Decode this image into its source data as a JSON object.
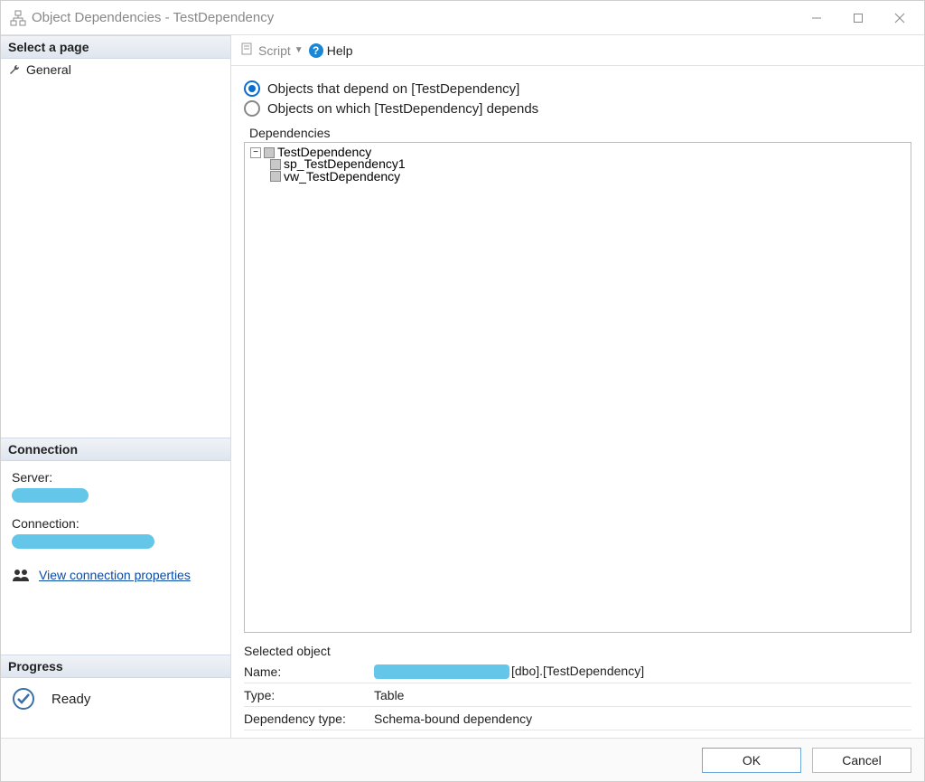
{
  "titlebar": {
    "title": "Object Dependencies - TestDependency"
  },
  "left": {
    "select_page_header": "Select a page",
    "pages": {
      "general": "General"
    },
    "connection_header": "Connection",
    "server_label": "Server:",
    "connection_label": "Connection:",
    "view_conn_props": "View connection properties",
    "progress_header": "Progress",
    "progress_status": "Ready"
  },
  "toolbar": {
    "script": "Script",
    "help": "Help"
  },
  "main": {
    "radio_depend_on": "Objects that depend on [TestDependency]",
    "radio_depends": "Objects on which [TestDependency] depends",
    "dependencies_label": "Dependencies",
    "tree": {
      "root": "TestDependency",
      "child1": "sp_TestDependency1",
      "child2": "vw_TestDependency"
    },
    "selected_heading": "Selected object",
    "name_label": "Name:",
    "name_value_suffix": "[dbo].[TestDependency]",
    "type_label": "Type:",
    "type_value": "Table",
    "deptype_label": "Dependency type:",
    "deptype_value": "Schema-bound dependency"
  },
  "footer": {
    "ok": "OK",
    "cancel": "Cancel"
  }
}
